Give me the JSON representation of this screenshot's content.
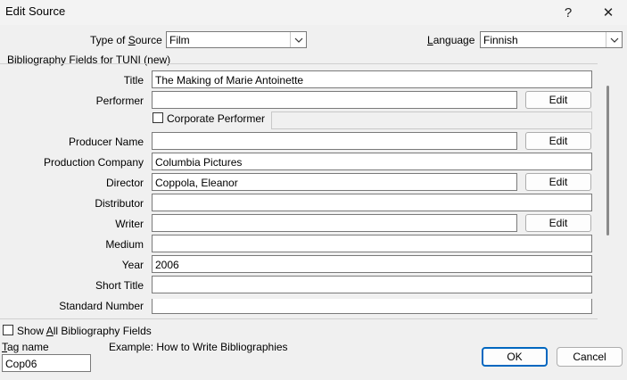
{
  "window": {
    "title": "Edit Source",
    "help_glyph": "?",
    "close_glyph": "✕"
  },
  "source_type": {
    "label_pre": "Type of ",
    "label_key": "S",
    "label_post": "ource",
    "value": "Film"
  },
  "language": {
    "label_key": "L",
    "label_post": "anguage",
    "value": "Finnish"
  },
  "group_label": "Bibliography Fields for TUNI (new)",
  "fields": {
    "title": {
      "label": "Title",
      "value": "The Making of Marie Antoinette"
    },
    "performer": {
      "label": "Performer",
      "value": "",
      "edit": "Edit"
    },
    "corporate_performer": {
      "label": "Corporate Performer",
      "checked": false
    },
    "producer_name": {
      "label": "Producer Name",
      "value": "",
      "edit": "Edit"
    },
    "production_company": {
      "label": "Production Company",
      "value": "Columbia Pictures"
    },
    "director": {
      "label": "Director",
      "value": "Coppola, Eleanor",
      "edit": "Edit"
    },
    "distributor": {
      "label": "Distributor",
      "value": ""
    },
    "writer": {
      "label": "Writer",
      "value": "",
      "edit": "Edit"
    },
    "medium": {
      "label": "Medium",
      "value": ""
    },
    "year": {
      "label": "Year",
      "value": "2006"
    },
    "short_title": {
      "label": "Short Title",
      "value": ""
    },
    "standard_number": {
      "label": "Standard Number",
      "value": ""
    }
  },
  "show_all": {
    "label_pre": "Show ",
    "label_key": "A",
    "label_post": "ll Bibliography Fields",
    "checked": false
  },
  "tag": {
    "label_key": "T",
    "label_post": "ag name",
    "value": "Cop06"
  },
  "example": "Example: How to Write Bibliographies",
  "buttons": {
    "ok": "OK",
    "cancel": "Cancel"
  },
  "icons": {
    "dropdown": "chevron-down-icon",
    "help": "help-icon",
    "close": "close-icon",
    "checkbox": "checkbox-icon"
  }
}
